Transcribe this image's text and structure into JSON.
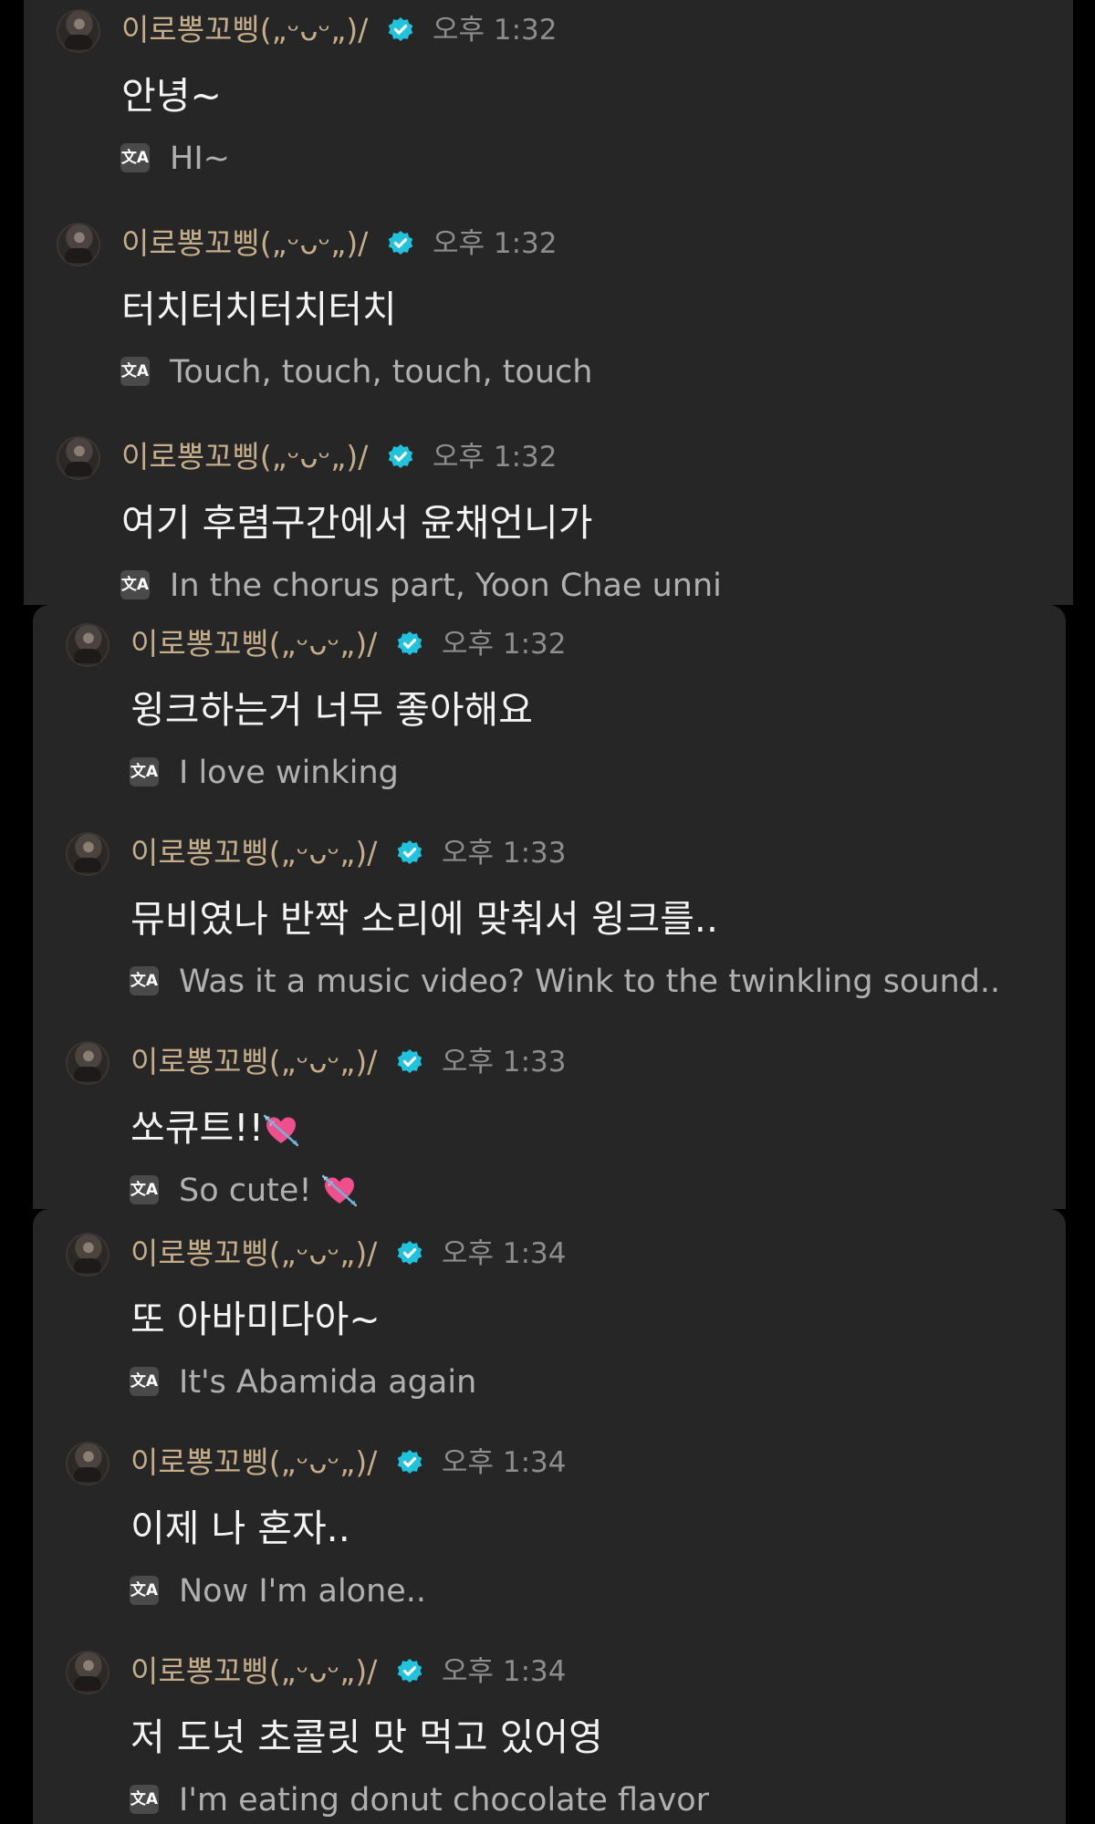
{
  "messages": [
    {
      "username": "이로뽕꼬삥(„ᵕᴗᵕ„)/",
      "time": "오후 1:32",
      "text": "안녕~",
      "translation": "HI~"
    },
    {
      "username": "이로뽕꼬삥(„ᵕᴗᵕ„)/",
      "time": "오후 1:32",
      "text": "터치터치터치터치",
      "translation": "Touch, touch, touch, touch"
    },
    {
      "username": "이로뽕꼬삥(„ᵕᴗᵕ„)/",
      "time": "오후 1:32",
      "text": "여기 후렴구간에서 윤채언니가",
      "translation": "In the chorus part, Yoon Chae unni"
    },
    {
      "username": "이로뽕꼬삥(„ᵕᴗᵕ„)/",
      "time": "오후 1:32",
      "text": "윙크하는거 너무 좋아해요",
      "translation": "I love winking"
    },
    {
      "username": "이로뽕꼬삥(„ᵕᴗᵕ„)/",
      "time": "오후 1:33",
      "text": "뮤비였나 반짝 소리에 맞춰서 윙크를..",
      "translation": "Was it a music video?  Wink to the twinkling sound.."
    },
    {
      "username": "이로뽕꼬삥(„ᵕᴗᵕ„)/",
      "time": "오후 1:33",
      "text": "쏘큐트!!",
      "translation": "So cute! "
    },
    {
      "username": "이로뽕꼬삥(„ᵕᴗᵕ„)/",
      "time": "오후 1:34",
      "text": "또 아바미다아~",
      "translation": "It's Abamida again"
    },
    {
      "username": "이로뽕꼬삥(„ᵕᴗᵕ„)/",
      "time": "오후 1:34",
      "text": "이제 나 혼자..",
      "translation": "Now I'm alone.."
    },
    {
      "username": "이로뽕꼬삥(„ᵕᴗᵕ„)/",
      "time": "오후 1:34",
      "text": "저 도넛 초콜릿 맛 먹고 있어영",
      "translation": "I'm eating donut chocolate flavor"
    }
  ],
  "icons": {
    "translate_glyph": "文A",
    "verified_badge": "verified-badge-icon",
    "heart": "heart-with-arrow-icon"
  },
  "colors": {
    "panel_background": "#262626",
    "page_background": "#000000",
    "username": "#c4ad8a",
    "timestamp": "#8d8d8d",
    "message_text": "#f3f3f3",
    "translation_text": "#b0b0b0",
    "verified_badge": "#21c2dc",
    "heart": "#ef4f8d"
  }
}
